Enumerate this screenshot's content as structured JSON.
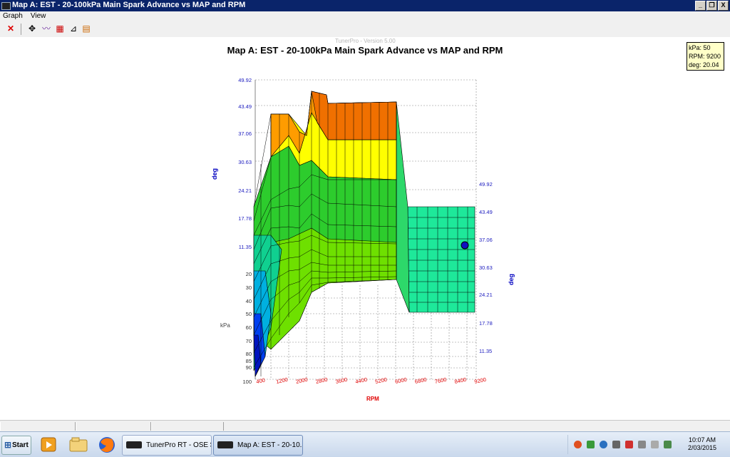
{
  "window": {
    "title": "Map A: EST - 20-100kPa Main Spark Advance vs MAP and RPM",
    "buttons": {
      "minimize": "_",
      "restore": "❐",
      "close": "X"
    }
  },
  "menu": {
    "items": [
      "Graph",
      "View"
    ]
  },
  "toolbar": {
    "icons": [
      "close-red-x-icon",
      "crosshair-icon",
      "line-graph-icon",
      "surface-graph-icon",
      "flat-surface-icon",
      "table-color-icon"
    ]
  },
  "version_text": "TunerPro - Version 5.00",
  "readout": {
    "kpa": "kPa: 50",
    "rpm": "RPM: 9200",
    "deg": "deg: 20.04"
  },
  "chart_data": {
    "type": "surface3d",
    "title": "Map A: EST - 20-100kPa Main Spark Advance vs MAP and RPM",
    "z_axis_label": "deg",
    "z_ticks_left": [
      "49.92",
      "43.49",
      "37.06",
      "30.63",
      "24.21",
      "17.78",
      "11.35"
    ],
    "z_ticks_right": [
      "49.92",
      "43.49",
      "37.06",
      "30.63",
      "24.21",
      "17.78",
      "11.35"
    ],
    "y_axis_label": "kPa",
    "y_ticks": [
      "20",
      "30",
      "40",
      "50",
      "60",
      "70",
      "80",
      "85",
      "90",
      "100"
    ],
    "x_axis_label": "RPM",
    "x_ticks": [
      "400",
      "1200",
      "2000",
      "2800",
      "3600",
      "4400",
      "5200",
      "6000",
      "6800",
      "7600",
      "8400",
      "9200"
    ],
    "cursor": {
      "kpa": 50,
      "rpm": 9200,
      "deg": 20.04
    },
    "colors": {
      "high": "#e86a00",
      "upper": "#ffff00",
      "mid": "#2dcc2d",
      "flat": "#1ee89a",
      "low": "#0015e0"
    }
  },
  "taskbar": {
    "start_label": "Start",
    "tasks": [
      "TunerPro RT - OSE $...",
      "Map A: EST - 20-10..."
    ],
    "clock_time": "10:07 AM",
    "clock_date": "2/03/2015"
  }
}
